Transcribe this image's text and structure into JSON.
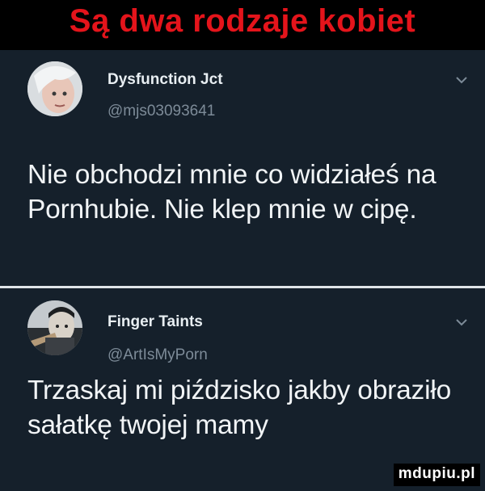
{
  "banner": {
    "title": "Są dwa rodzaje kobiet"
  },
  "tweets": [
    {
      "name": "Dysfunction Jct",
      "handle": "@mjs03093641",
      "text": "Nie obchodzi mnie co widziałeś na Pornhubie. Nie klep mnie w cipę.",
      "avatar_icon": "avatar-photo"
    },
    {
      "name": "Finger Taints",
      "handle": "@ArtIsMyPorn",
      "text": "Trzaskaj mi piździsko jakby obraziło sałatkę twojej mamy",
      "avatar_icon": "avatar-photo"
    }
  ],
  "watermark": {
    "text": "mdupiu.pl"
  },
  "colors": {
    "banner_bg": "#000000",
    "banner_text": "#e4141b",
    "panel_bg": "#15202b",
    "handle": "#7d8b98"
  }
}
